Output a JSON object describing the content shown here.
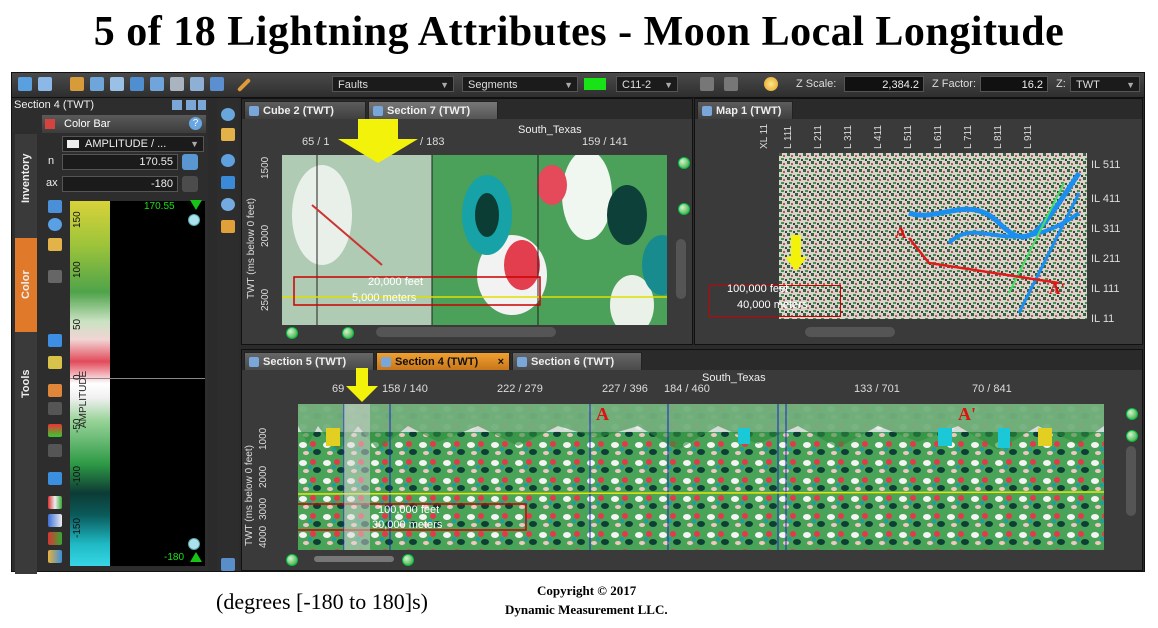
{
  "title": "5 of 18 Lightning Attributes - Moon Local Longitude",
  "caption": "(degrees [-180 to 180]s)",
  "copyright": {
    "line1": "Copyright  © 2017",
    "line2": "Dynamic Measurement LLC."
  },
  "toolbar": {
    "faults_dropdown": "Faults",
    "segments_dropdown": "Segments",
    "horizon_dropdown": "C11-2",
    "zscale_label": "Z Scale:",
    "zscale_value": "2,384.2",
    "zfactor_label": "Z Factor:",
    "zfactor_value": "16.2",
    "z_label": "Z:",
    "z_dropdown": "TWT",
    "accent_green": "#17e317"
  },
  "left_panel": {
    "title": "Section 4 (TWT)",
    "vtabs": [
      "Inventory",
      "Color",
      "Tools"
    ],
    "colorbar": {
      "header": "Color Bar",
      "attribute": "AMPLITUDE / ...",
      "max_label": "n",
      "max_value": "170.55",
      "min_label": "ax",
      "min_value": "-180",
      "top_value": "170.55",
      "bottom_value": "-180",
      "axis_label": "AMPLITUDE",
      "ticks": [
        "150",
        "100",
        "50",
        "0",
        "-50",
        "-100",
        "-150"
      ]
    }
  },
  "cube_panel": {
    "tabs": [
      "Cube 2 (TWT)",
      "Section 7 (TWT)"
    ],
    "location": "South_Texas",
    "top_ticks": [
      "65 / 1",
      "/ 183",
      "159 / 141"
    ],
    "y_axis_label": "TWT (ms below 0 feet)",
    "y_ticks": [
      "1500",
      "2000",
      "2500"
    ],
    "scale_feet": "20,000 feet",
    "scale_meters": "5,000 meters"
  },
  "map_panel": {
    "tab": "Map 1 (TWT)",
    "top_labels": [
      "XL 11",
      "L 111",
      "L 211",
      "L 311",
      "L 411",
      "L 511",
      "L 611",
      "L 711",
      "L 811",
      "L 911"
    ],
    "right_labels": [
      "IL 511",
      "IL 411",
      "IL 311",
      "IL 211",
      "IL 111",
      "IL 11"
    ],
    "marker_a": "A",
    "marker_a2": "A'",
    "scale_feet": "100,000 feet",
    "scale_meters": "40,000 meters"
  },
  "section_panel": {
    "tabs": [
      "Section 5 (TWT)",
      "Section 4 (TWT)",
      "Section 6 (TWT)"
    ],
    "active_tab_close": "×",
    "location": "South_Texas",
    "top_ticks": [
      "69",
      "158 / 140",
      "222 / 279",
      "227 / 396",
      "184 / 460",
      "133 / 701",
      "70 / 841"
    ],
    "y_axis_label": "TWT (ms below 0 feet)",
    "y_ticks": [
      "1000",
      "2000",
      "3000",
      "4000"
    ],
    "marker_a": "A",
    "marker_a2": "A'",
    "scale_feet": "100,000 feet",
    "scale_meters": "30,000 meters"
  }
}
